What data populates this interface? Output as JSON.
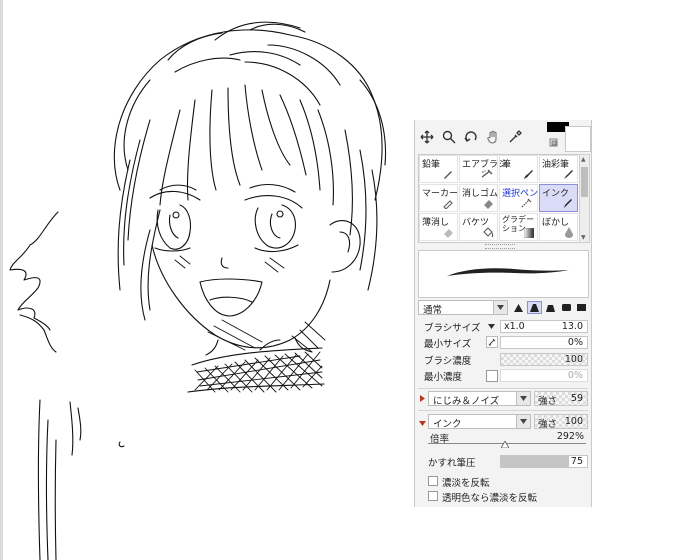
{
  "brush_grid": {
    "items": [
      {
        "label": "鉛筆",
        "icon": "pencil-icon"
      },
      {
        "label": "エアブラシ",
        "icon": "airbrush-icon"
      },
      {
        "label": "筆",
        "icon": "brush-icon"
      },
      {
        "label": "油彩筆",
        "icon": "oil-brush-icon"
      },
      {
        "label": "マーカー",
        "icon": "marker-icon"
      },
      {
        "label": "消しゴム",
        "icon": "eraser-icon"
      },
      {
        "label": "選択ペン",
        "icon": "selection-pen-icon"
      },
      {
        "label": "インク",
        "icon": "ink-pen-icon"
      },
      {
        "label": "薄消し",
        "icon": "light-eraser-icon"
      },
      {
        "label": "バケツ",
        "icon": "bucket-icon"
      },
      {
        "label": "グラデーション",
        "icon": "gradient-icon"
      },
      {
        "label": "ぼかし",
        "icon": "blur-icon"
      }
    ],
    "selected": "インク"
  },
  "blend": {
    "value": "通常"
  },
  "brush_size": {
    "label": "ブラシサイズ",
    "multiplier": "x1.0",
    "value": "13.0"
  },
  "min_size": {
    "label": "最小サイズ",
    "value": "0%"
  },
  "brush_density": {
    "label": "ブラシ濃度",
    "value": "100"
  },
  "min_density": {
    "label": "最小濃度",
    "value": "0%"
  },
  "texture": {
    "value": "にじみ＆ノイズ",
    "strength_label": "強さ",
    "strength": "59"
  },
  "brush_type": {
    "value": "インク",
    "strength_label": "強さ",
    "strength": "100"
  },
  "magnification": {
    "label": "倍率",
    "value": "292%",
    "fraction": 0.49
  },
  "blur_pressure": {
    "label": "かすれ筆圧",
    "value": "75"
  },
  "invert_density": {
    "label": "濃淡を反転"
  },
  "invert_transparent": {
    "label": "透明色なら濃淡を反転"
  },
  "colors": {
    "foreground": "#000000",
    "background": "#ffffff",
    "selected_cell": "#d9dbf7",
    "accent_blue": "#1d37d8"
  }
}
